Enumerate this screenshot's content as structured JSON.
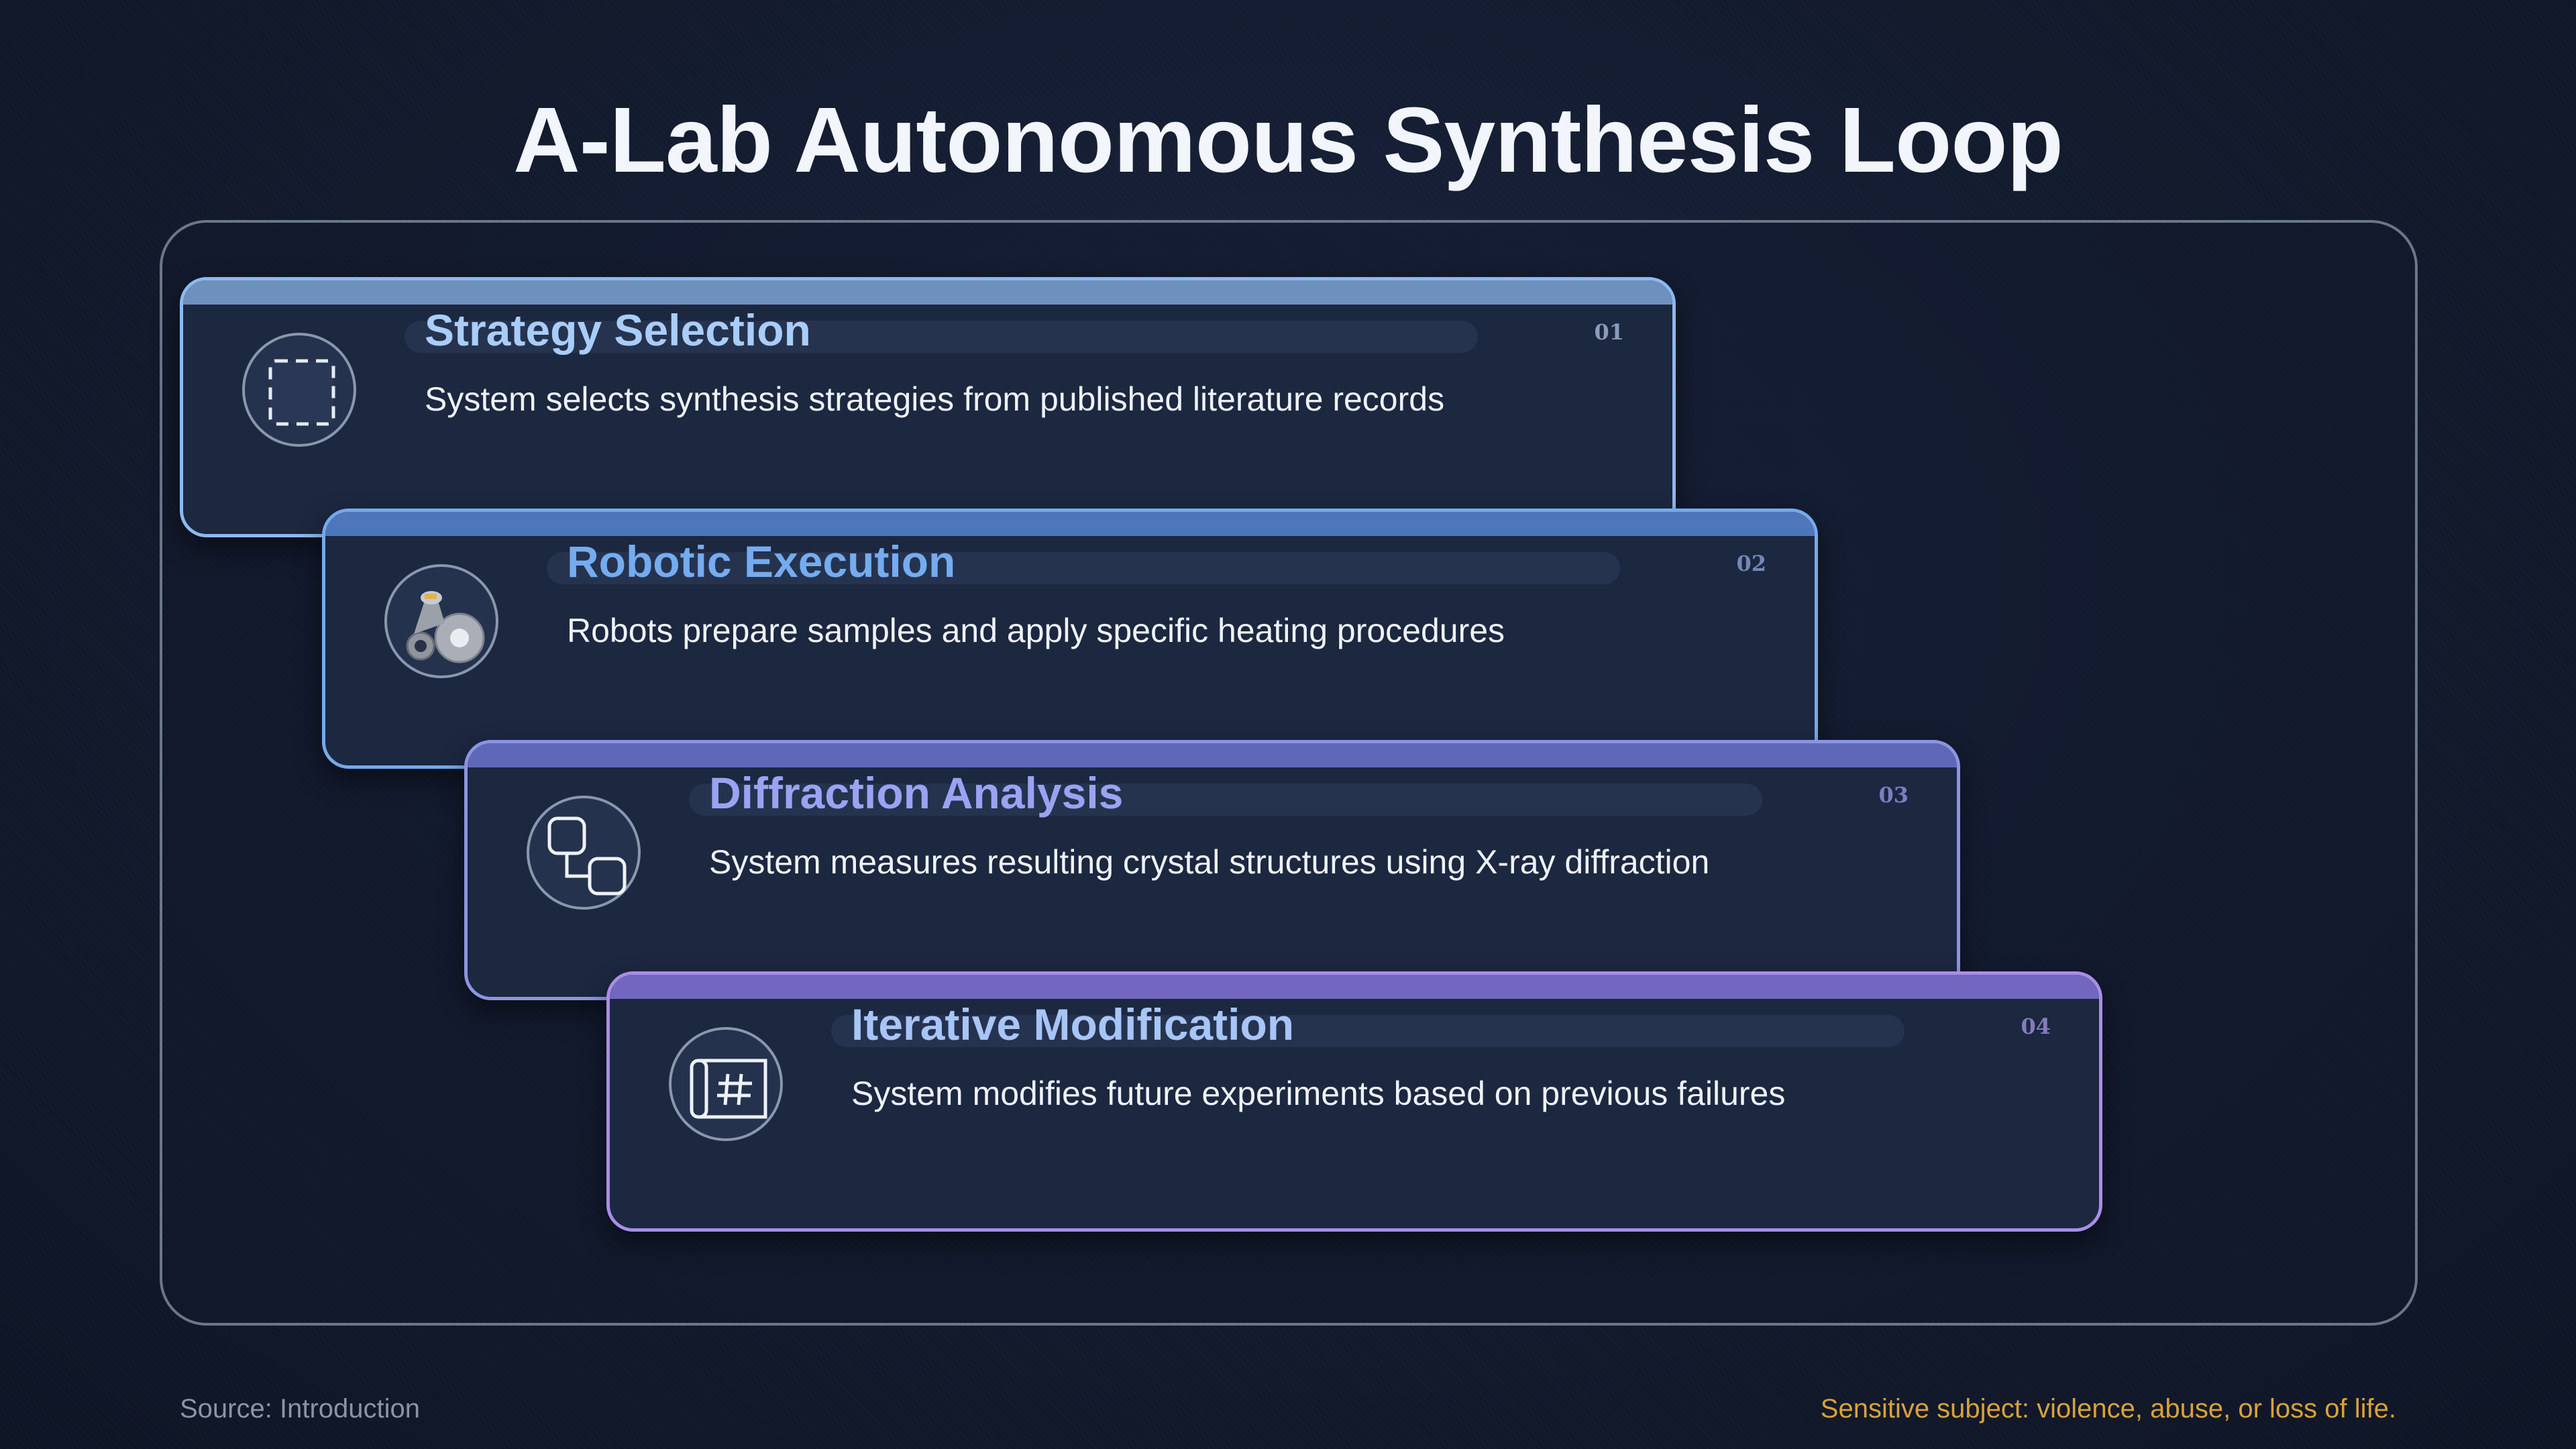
{
  "title": "A-Lab Autonomous Synthesis Loop",
  "steps": [
    {
      "number": "01",
      "title": "Strategy Selection",
      "description": "System selects synthesis strategies from published literature records",
      "icon": "selection-icon"
    },
    {
      "number": "02",
      "title": "Robotic Execution",
      "description": "Robots prepare samples and apply specific heating procedures",
      "icon": "robot-arm-icon"
    },
    {
      "number": "03",
      "title": "Diffraction Analysis",
      "description": "System measures resulting crystal structures using X-ray diffraction",
      "icon": "workflow-icon"
    },
    {
      "number": "04",
      "title": "Iterative Modification",
      "description": "System modifies future experiments based on previous failures",
      "icon": "blueprint-icon"
    }
  ],
  "footer": {
    "source": "Source: Introduction",
    "note": "Sensitive subject: violence, abuse, or loss of life."
  },
  "colors": {
    "background": "#121a2d",
    "card": "#1c2740",
    "note": "#d8a23a",
    "step_titles": [
      "#a9cdfa",
      "#74acef",
      "#9aa3f2",
      "#a7c5f6"
    ],
    "step_borders": [
      "#8cb9ef",
      "#76a9ea",
      "#8c95e2",
      "#a98ee6"
    ]
  }
}
